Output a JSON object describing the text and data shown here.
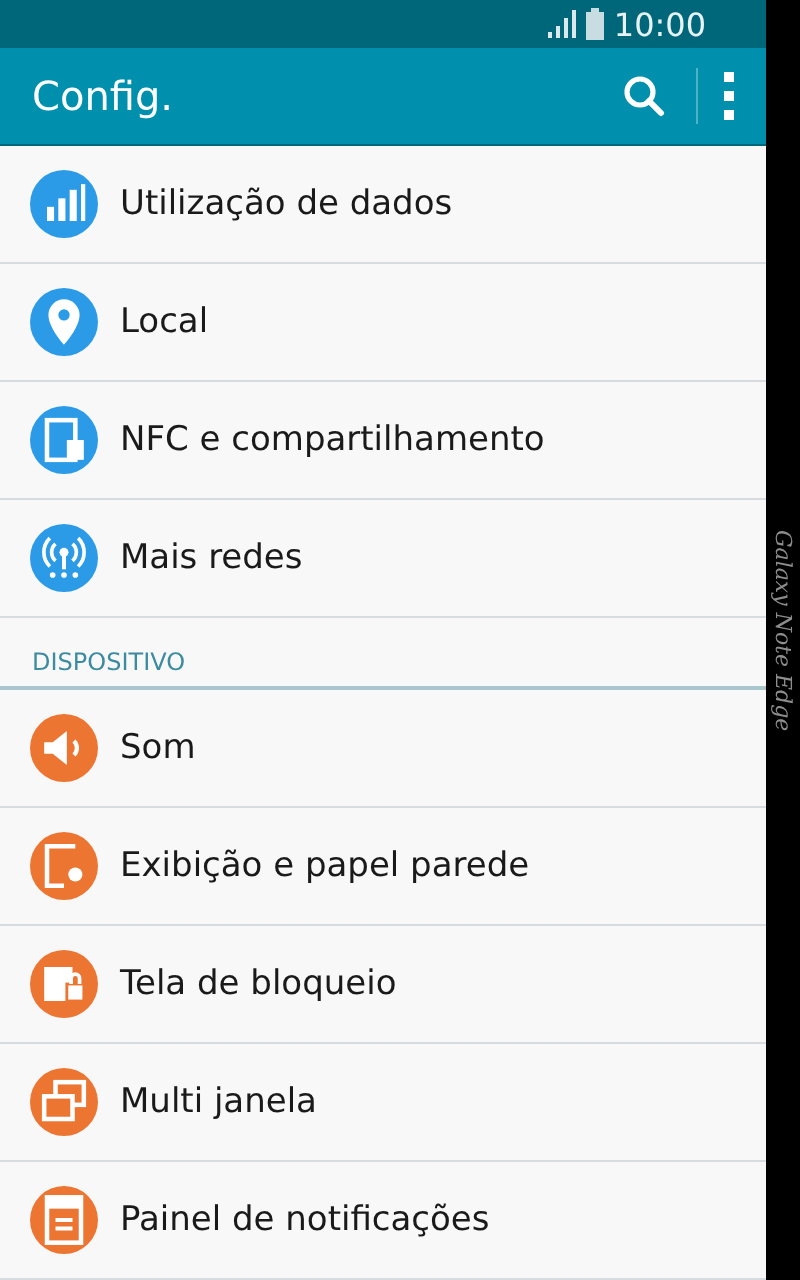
{
  "status_bar": {
    "time": "10:00"
  },
  "app_bar": {
    "title": "Config."
  },
  "sections": [
    {
      "items": [
        {
          "label": "Utilização de dados",
          "color": "#2b9be8"
        },
        {
          "label": "Local",
          "color": "#2b9be8"
        },
        {
          "label": "NFC e compartilhamento",
          "color": "#2b9be8"
        },
        {
          "label": "Mais redes",
          "color": "#2b9be8"
        }
      ]
    },
    {
      "header": "DISPOSITIVO",
      "items": [
        {
          "label": "Som",
          "color": "#ec7532"
        },
        {
          "label": "Exibição e papel parede",
          "color": "#ec7532"
        },
        {
          "label": "Tela de bloqueio",
          "color": "#ec7532"
        },
        {
          "label": "Multi janela",
          "color": "#ec7532"
        },
        {
          "label": "Painel de notificações",
          "color": "#ec7532"
        }
      ]
    }
  ],
  "edge_panel": {
    "text": "Galaxy Note Edge"
  }
}
